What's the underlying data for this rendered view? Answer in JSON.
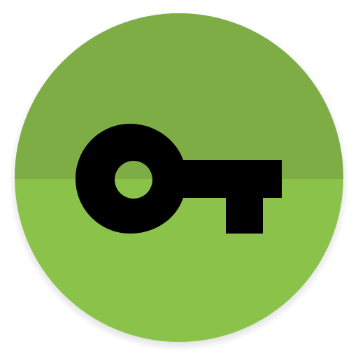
{
  "icon": {
    "name": "key-icon",
    "colors": {
      "circle_upper": "#7fad45",
      "circle_lower": "#8bc34a",
      "key": "#000000",
      "shadow": "#000000"
    }
  }
}
